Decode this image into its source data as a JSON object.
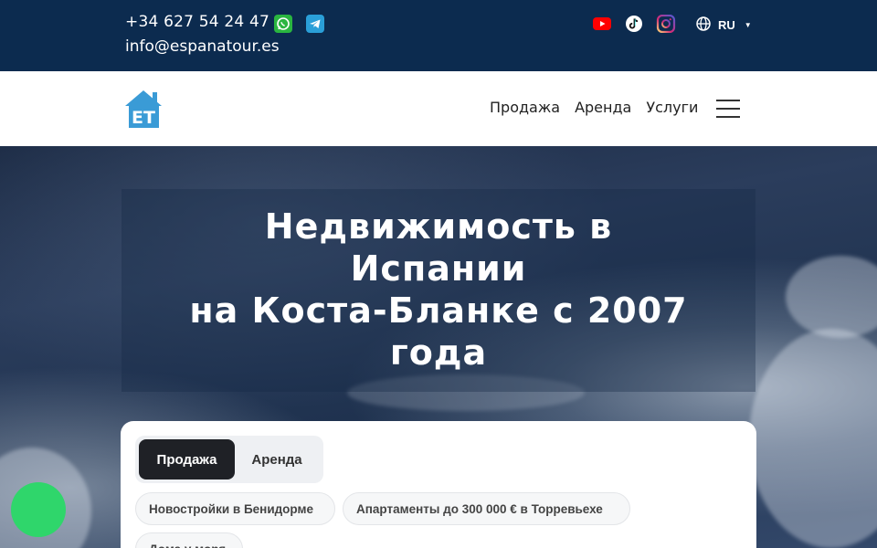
{
  "topbar": {
    "phone": "+34 627 54 24 47",
    "email": "info@espanatour.es",
    "messengers": [
      {
        "icon": "whatsapp-icon",
        "color": "#2ab540"
      },
      {
        "icon": "telegram-icon",
        "color": "#2a9fd8"
      }
    ],
    "social": [
      {
        "icon": "youtube-icon",
        "color": "#ff0000"
      },
      {
        "icon": "tiktok-icon",
        "color": "#ffffff"
      },
      {
        "icon": "instagram-icon",
        "color": "#d62976"
      }
    ],
    "language": {
      "icon": "globe-icon",
      "label": "RU"
    },
    "background": "#0c2b4f"
  },
  "nav": {
    "logo": {
      "icon": "house-logo",
      "color": "#3a9bd6",
      "text": "ET"
    },
    "links": [
      "Продажа",
      "Аренда",
      "Услуги"
    ],
    "menu_icon": "hamburger-icon"
  },
  "hero": {
    "title_lines": [
      "Недвижимость в",
      "Испании",
      "на Коста-Бланке с 2007",
      "года"
    ]
  },
  "search": {
    "tabs": [
      {
        "label": "Продажа",
        "active": true
      },
      {
        "label": "Аренда",
        "active": false
      }
    ],
    "chips": [
      "Новостройки в Бенидорме",
      "Апартаменты до 300 000 € в Торревьехе",
      "Дома у моря"
    ]
  },
  "chat_button": {
    "icon": "chat-icon",
    "color": "#2fd66b"
  }
}
